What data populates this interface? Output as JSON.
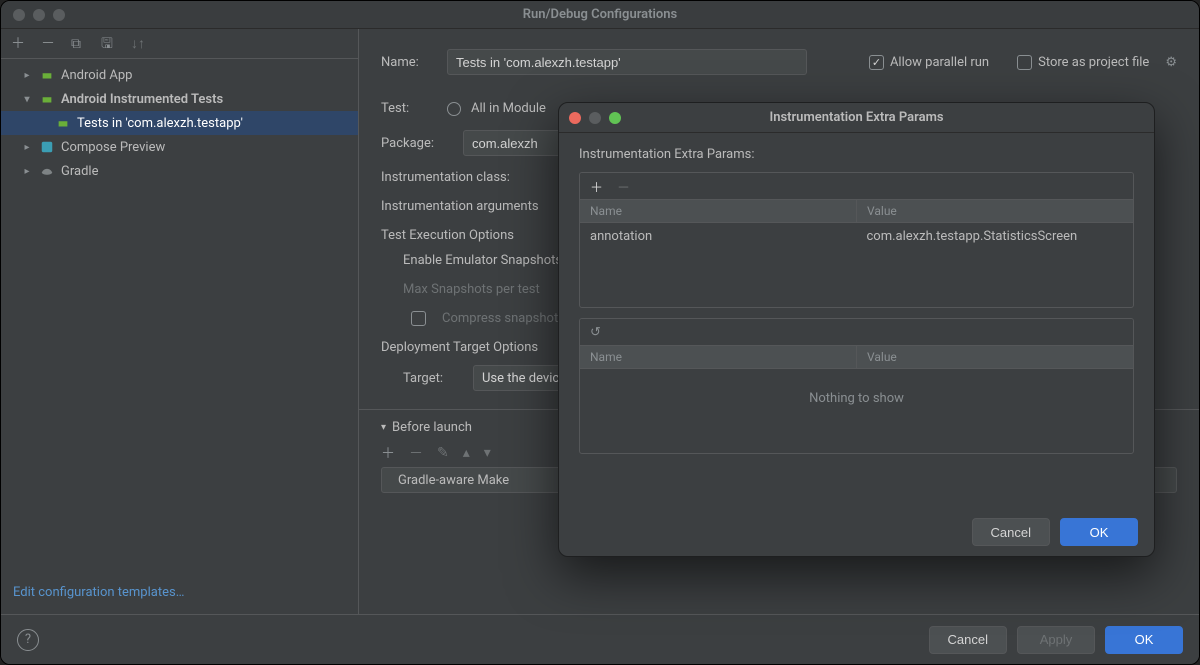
{
  "window": {
    "title": "Run/Debug Configurations"
  },
  "tree": {
    "androidApp": {
      "label": "Android App"
    },
    "instrTests": {
      "label": "Android Instrumented Tests"
    },
    "testsIn": {
      "label": "Tests in 'com.alexzh.testapp'"
    },
    "composePrev": {
      "label": "Compose Preview"
    },
    "gradle": {
      "label": "Gradle"
    }
  },
  "leftFooter": {
    "editTemplates": "Edit configuration templates…"
  },
  "form": {
    "nameLabel": "Name:",
    "nameValue": "Tests in 'com.alexzh.testapp'",
    "allowParallel": "Allow parallel run",
    "storeAsFile": "Store as project file",
    "testLabel": "Test:",
    "allInModule": "All in Module",
    "packageLabel": "Package:",
    "packageValue": "com.alexzh",
    "instrClass": "Instrumentation class:",
    "instrArgs": "Instrumentation arguments",
    "testExecHdr": "Test Execution Options",
    "enableSnap": "Enable Emulator Snapshots",
    "maxSnap": "Max Snapshots per test",
    "compress": "Compress snapshots",
    "deployHdr": "Deployment Target Options",
    "targetLabel": "Target:",
    "targetValue": "Use the device...",
    "beforeLaunch": "Before launch",
    "taskLabel": "Gradle-aware Make"
  },
  "buttons": {
    "cancel": "Cancel",
    "apply": "Apply",
    "ok": "OK"
  },
  "dialog": {
    "title": "Instrumentation Extra Params",
    "heading": "Instrumentation Extra Params:",
    "colName": "Name",
    "colValue": "Value",
    "row1Name": "annotation",
    "row1Value": "com.alexzh.testapp.StatisticsScreen",
    "nothing": "Nothing to show",
    "cancel": "Cancel",
    "ok": "OK"
  }
}
